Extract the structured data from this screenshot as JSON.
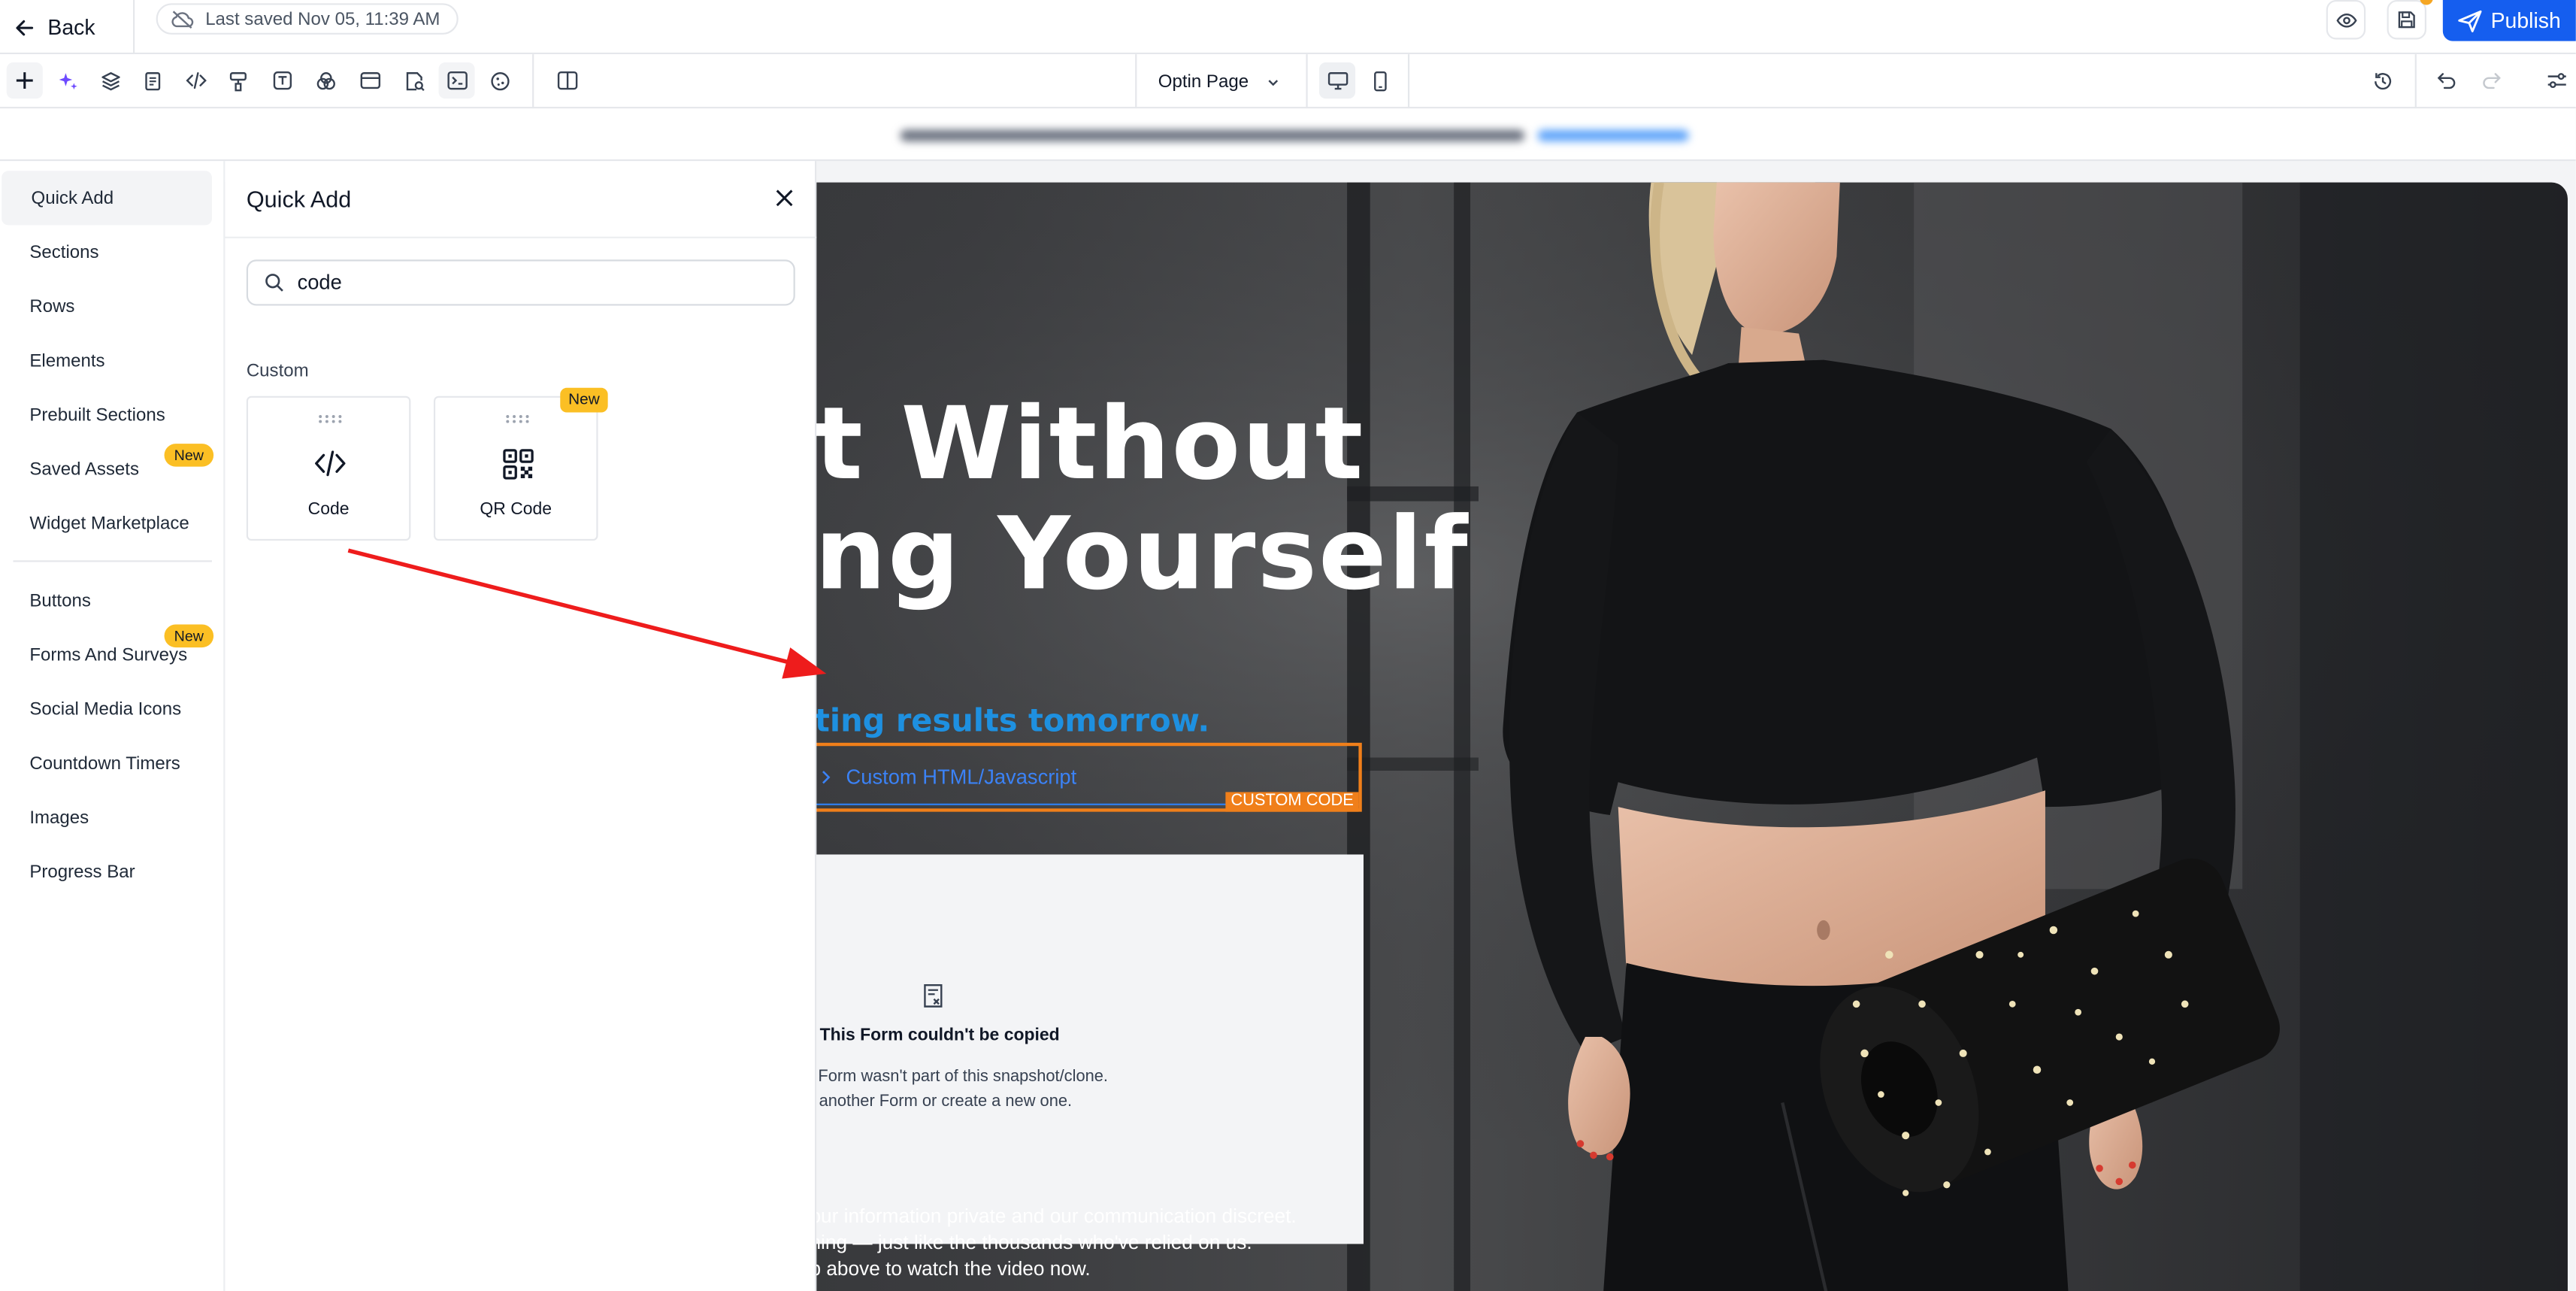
{
  "topbar": {
    "back_label": "Back",
    "saved_status": "Last saved Nov 05, 11:39 AM",
    "publish_label": "Publish"
  },
  "toolbar": {
    "page_name": "Optin Page",
    "tools": [
      "add-icon",
      "ai-sparkle-icon",
      "layers-icon",
      "pages-icon",
      "code-icon",
      "paint-icon",
      "text-icon",
      "color-icon",
      "layout-icon",
      "seo-icon",
      "terminal-icon",
      "settings-icon",
      "split-view-icon"
    ],
    "right_tools": [
      "history-icon",
      "undo-icon",
      "redo-icon",
      "sliders-icon"
    ]
  },
  "leftnav": {
    "items": [
      {
        "label": "Quick Add",
        "active": true
      },
      {
        "label": "Sections"
      },
      {
        "label": "Rows"
      },
      {
        "label": "Elements"
      },
      {
        "label": "Prebuilt Sections"
      },
      {
        "label": "Saved Assets",
        "badge": "New"
      },
      {
        "label": "Widget Marketplace"
      },
      {
        "label": "Buttons"
      },
      {
        "label": "Forms And Surveys",
        "badge": "New"
      },
      {
        "label": "Social Media Icons"
      },
      {
        "label": "Countdown Timers"
      },
      {
        "label": "Images"
      },
      {
        "label": "Progress Bar"
      }
    ]
  },
  "panel": {
    "title": "Quick Add",
    "search_value": "code",
    "category_label": "Custom",
    "cards": [
      {
        "label": "Code",
        "icon": "code-icon"
      },
      {
        "label": "QR Code",
        "icon": "qr-code-icon",
        "badge": "New"
      }
    ]
  },
  "canvas": {
    "headline_line1": "t Without",
    "headline_line2": "ng Yourself",
    "subheadline": "ting results tomorrow.",
    "custom_code_label": "Custom HTML/Javascript",
    "custom_code_tag": "CUSTOM CODE",
    "form_error_title": "This Form couldn't be copied",
    "form_error_line1": "l Form wasn't part of this snapshot/clone.",
    "form_error_line2": "t another Form or create a new one.",
    "footer_line1": "our information private and our communication discreet.",
    "footer_line2": "hing — just like the thousands who've relied on us.",
    "footer_line3": "p above to watch the video now."
  },
  "colors": {
    "brand_blue": "#155eef",
    "badge_yellow": "#fbbf24",
    "selection_orange": "#f07f1a",
    "subhead_blue": "#1e90e0",
    "annotation_red": "#ee1c1c"
  }
}
